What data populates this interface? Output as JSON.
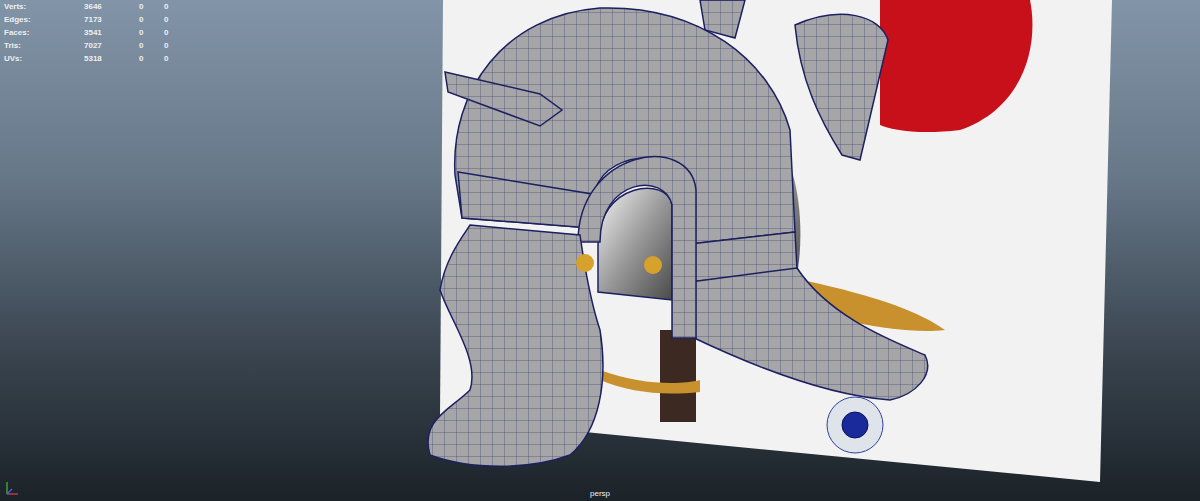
{
  "hud": {
    "rows": [
      {
        "label": "Verts:",
        "values": [
          "3646",
          "0",
          "0"
        ]
      },
      {
        "label": "Edges:",
        "values": [
          "7173",
          "0",
          "0"
        ]
      },
      {
        "label": "Faces:",
        "values": [
          "3541",
          "0",
          "0"
        ]
      },
      {
        "label": "Tris:",
        "values": [
          "7027",
          "0",
          "0"
        ]
      },
      {
        "label": "UVs:",
        "values": [
          "5318",
          "0",
          "0"
        ]
      }
    ]
  },
  "camera": {
    "label": "persp"
  }
}
